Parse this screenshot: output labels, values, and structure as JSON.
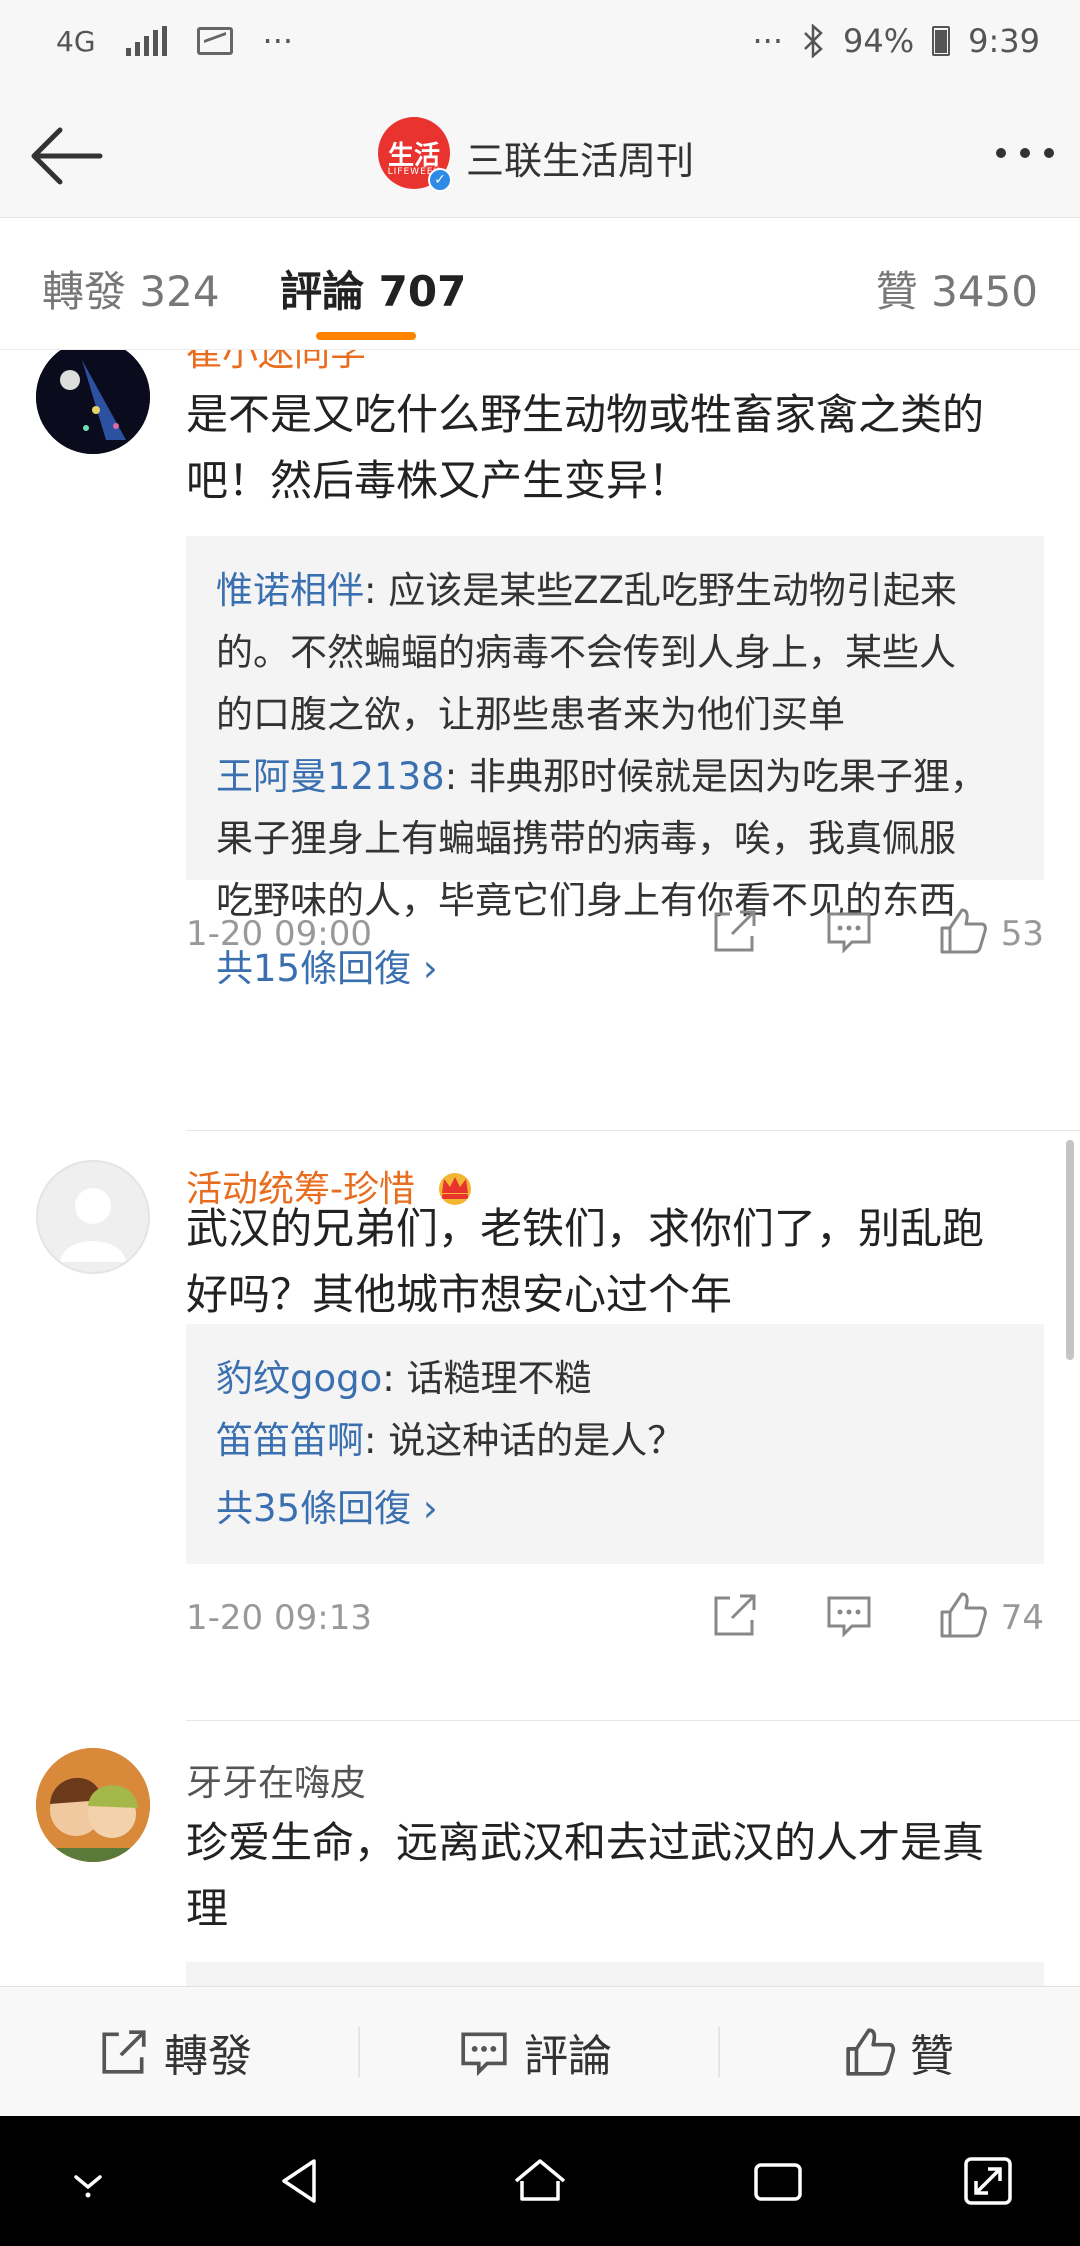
{
  "status_bar": {
    "network": "4G",
    "overflow_left": "···",
    "overflow_right": "···",
    "battery": "94%",
    "time": "9:39"
  },
  "header": {
    "account_name": "三联生活周刊",
    "logo_text": "生活",
    "logo_subtext": "LIFEWEEK"
  },
  "tabs": [
    {
      "label": "轉發",
      "count": "324"
    },
    {
      "label": "評論",
      "count": "707"
    },
    {
      "label": "贊",
      "count": "3450"
    }
  ],
  "comments": [
    {
      "username": "崔小迷同学",
      "text_lines": [
        "是不是又吃什么野生动物或牲畜家禽之类的",
        "吧！然后毒株又产生变异！"
      ],
      "replies": [
        {
          "user": "惟诺相伴",
          "lines": [
            ": 应该是某些ZZ乱吃野生动物引起来",
            "的。不然蝙蝠的病毒不会传到人身上，某些人",
            "的口腹之欲，让那些患者来为他们买单"
          ]
        },
        {
          "user": "王阿曼12138",
          "lines": [
            ": 非典那时候就是因为吃果子狸，",
            "果子狸身上有蝙蝠携带的病毒，唉，我真佩服",
            "吃野味的人，毕竟它们身上有你看不见的东西"
          ]
        }
      ],
      "more_replies": "共15條回復 ›",
      "time": "1-20 09:00",
      "likes": "53"
    },
    {
      "username": "活动统筹-珍惜",
      "text_lines": [
        "武汉的兄弟们，老铁们，求你们了，别乱跑",
        "好吗？其他城市想安心过个年"
      ],
      "replies": [
        {
          "user": "豹纹gogo",
          "lines": [
            ": 话糙理不糙"
          ]
        },
        {
          "user": "笛笛笛啊",
          "lines": [
            ": 说这种话的是人？"
          ]
        }
      ],
      "more_replies": "共35條回復 ›",
      "time": "1-20 09:13",
      "likes": "74"
    },
    {
      "username": "牙牙在嗨皮",
      "text_lines": [
        "珍爱生命，远离武汉和去过武汉的人才是真",
        "理"
      ]
    }
  ],
  "bottom_bar": {
    "repost": "轉發",
    "comment": "評論",
    "like": "贊"
  },
  "colors": {
    "accent_orange": "#ff8200",
    "link_blue": "#3a6fb0",
    "vip_name": "#e86d1f"
  }
}
